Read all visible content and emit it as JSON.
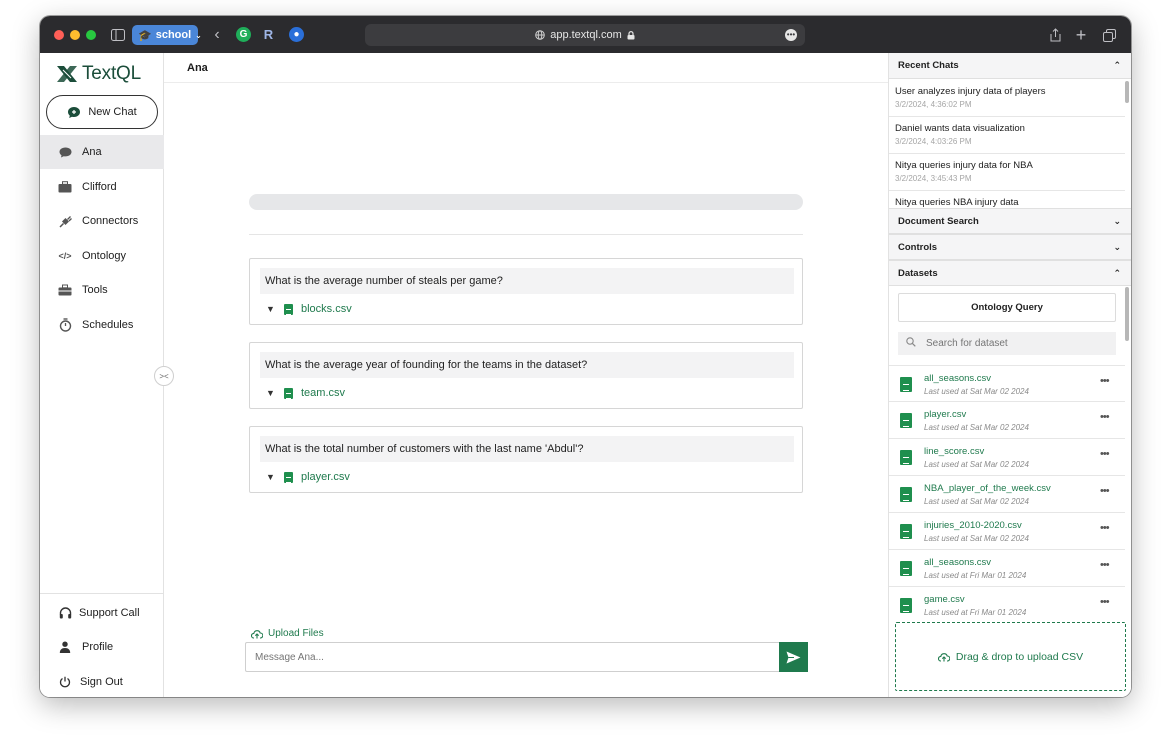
{
  "browser": {
    "profile_label": "school",
    "url": "app.textql.com"
  },
  "app": {
    "logo_text": "TextQL",
    "new_chat_label": "New Chat",
    "nav": [
      {
        "label": "Ana",
        "icon": "chat-bubble-icon"
      },
      {
        "label": "Clifford",
        "icon": "briefcase-icon"
      },
      {
        "label": "Connectors",
        "icon": "plug-icon"
      },
      {
        "label": "Ontology",
        "icon": "code-icon"
      },
      {
        "label": "Tools",
        "icon": "toolbox-icon"
      },
      {
        "label": "Schedules",
        "icon": "stopwatch-icon"
      }
    ],
    "bottom_nav": [
      {
        "label": "Support Call",
        "icon": "headphones-icon"
      },
      {
        "label": "Profile",
        "icon": "person-icon"
      },
      {
        "label": "Sign Out",
        "icon": "power-icon"
      }
    ]
  },
  "main": {
    "header_title": "Ana",
    "questions": [
      {
        "text": "What is the average number of steals per game?",
        "file": "blocks.csv"
      },
      {
        "text": "What is the average year of founding for the teams in the dataset?",
        "file": "team.csv"
      },
      {
        "text": "What is the total number of customers with the last name 'Abdul'?",
        "file": "player.csv"
      }
    ],
    "upload_label": "Upload Files",
    "message_placeholder": "Message Ana..."
  },
  "right_panel": {
    "recent_chats_title": "Recent Chats",
    "recent_chats": [
      {
        "title": "User analyzes injury data of players",
        "date": "3/2/2024, 4:36:02 PM"
      },
      {
        "title": "Daniel wants data visualization",
        "date": "3/2/2024, 4:03:26 PM"
      },
      {
        "title": "Nitya queries injury data for NBA",
        "date": "3/2/2024, 3:45:43 PM"
      },
      {
        "title": "Nitya queries NBA injury data",
        "date": ""
      }
    ],
    "document_search_title": "Document Search",
    "controls_title": "Controls",
    "datasets_title": "Datasets",
    "ontology_query_label": "Ontology Query",
    "search_placeholder": "Search for dataset",
    "datasets": [
      {
        "name": "all_seasons.csv",
        "last_used": "Last used at Sat Mar 02 2024"
      },
      {
        "name": "player.csv",
        "last_used": "Last used at Sat Mar 02 2024"
      },
      {
        "name": "line_score.csv",
        "last_used": "Last used at Sat Mar 02 2024"
      },
      {
        "name": "NBA_player_of_the_week.csv",
        "last_used": "Last used at Sat Mar 02 2024"
      },
      {
        "name": "injuries_2010-2020.csv",
        "last_used": "Last used at Sat Mar 02 2024"
      },
      {
        "name": "all_seasons.csv",
        "last_used": "Last used at Fri Mar 01 2024"
      },
      {
        "name": "game.csv",
        "last_used": "Last used at Fri Mar 01 2024"
      }
    ],
    "dropzone_label": "Drag & drop to upload CSV"
  },
  "colors": {
    "accent": "#1f7a4d",
    "brand": "#1b4d3a",
    "titlebar": "#2b2b2e"
  }
}
